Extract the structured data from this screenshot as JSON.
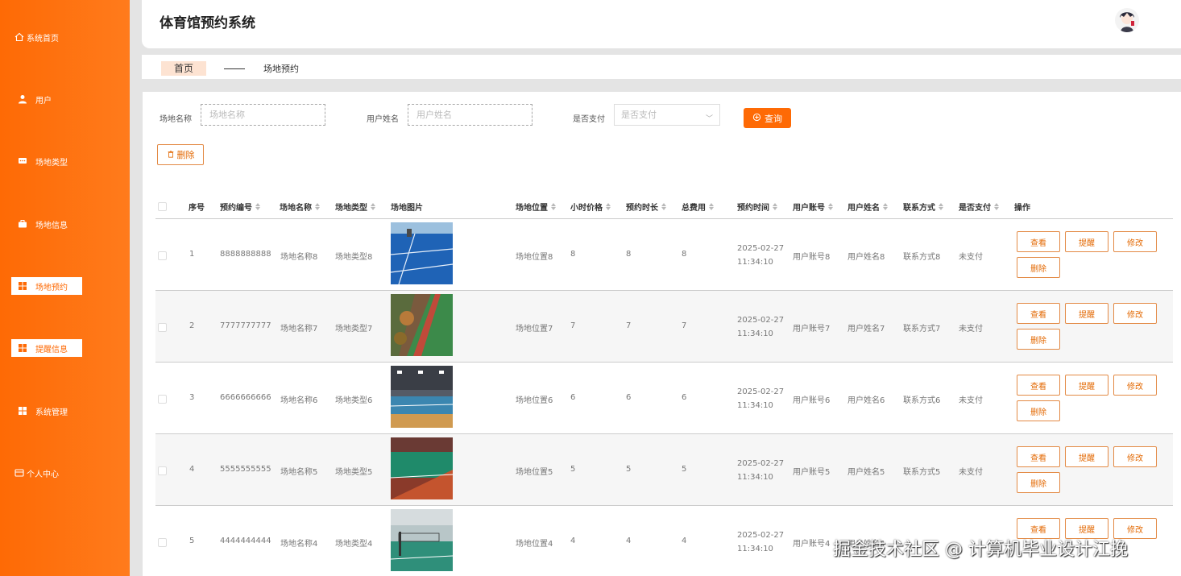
{
  "header": {
    "title": "体育馆预约系统"
  },
  "sidebar": {
    "items": [
      {
        "label": "系统首页",
        "icon": "home-icon"
      },
      {
        "label": "用户",
        "icon": "user-icon"
      },
      {
        "label": "场地类型",
        "icon": "message-icon"
      },
      {
        "label": "场地信息",
        "icon": "briefcase-icon"
      },
      {
        "label": "场地预约",
        "icon": "grid-icon"
      },
      {
        "label": "提醒信息",
        "icon": "grid-icon"
      },
      {
        "label": "系统管理",
        "icon": "grid-icon"
      },
      {
        "label": "个人中心",
        "icon": "card-icon"
      }
    ]
  },
  "breadcrumb": {
    "home": "首页",
    "current": "场地预约"
  },
  "search": {
    "venue_name_label": "场地名称",
    "venue_name_placeholder": "场地名称",
    "user_name_label": "用户姓名",
    "user_name_placeholder": "用户姓名",
    "paid_label": "是否支付",
    "paid_placeholder": "是否支付",
    "query_button": "查询"
  },
  "toolbar": {
    "delete_button": "删除"
  },
  "table": {
    "columns": [
      "序号",
      "预约编号",
      "场地名称",
      "场地类型",
      "场地图片",
      "场地位置",
      "小时价格",
      "预约时长",
      "总费用",
      "预约时间",
      "用户账号",
      "用户姓名",
      "联系方式",
      "是否支付",
      "操作"
    ],
    "actions": {
      "view": "查看",
      "remind": "提醒",
      "edit": "修改",
      "delete": "删除"
    },
    "rows": [
      {
        "index": "1",
        "code": "8888888888",
        "name": "场地名称8",
        "type": "场地类型8",
        "location": "场地位置8",
        "price": "8",
        "duration": "8",
        "total": "8",
        "date": "2025-02-27",
        "time": "11:34:10",
        "account": "用户账号8",
        "username": "用户姓名8",
        "contact": "联系方式8",
        "paid": "未支付"
      },
      {
        "index": "2",
        "code": "7777777777",
        "name": "场地名称7",
        "type": "场地类型7",
        "location": "场地位置7",
        "price": "7",
        "duration": "7",
        "total": "7",
        "date": "2025-02-27",
        "time": "11:34:10",
        "account": "用户账号7",
        "username": "用户姓名7",
        "contact": "联系方式7",
        "paid": "未支付"
      },
      {
        "index": "3",
        "code": "6666666666",
        "name": "场地名称6",
        "type": "场地类型6",
        "location": "场地位置6",
        "price": "6",
        "duration": "6",
        "total": "6",
        "date": "2025-02-27",
        "time": "11:34:10",
        "account": "用户账号6",
        "username": "用户姓名6",
        "contact": "联系方式6",
        "paid": "未支付"
      },
      {
        "index": "4",
        "code": "5555555555",
        "name": "场地名称5",
        "type": "场地类型5",
        "location": "场地位置5",
        "price": "5",
        "duration": "5",
        "total": "5",
        "date": "2025-02-27",
        "time": "11:34:10",
        "account": "用户账号5",
        "username": "用户姓名5",
        "contact": "联系方式5",
        "paid": "未支付"
      },
      {
        "index": "5",
        "code": "4444444444",
        "name": "场地名称4",
        "type": "场地类型4",
        "location": "场地位置4",
        "price": "4",
        "duration": "4",
        "total": "4",
        "date": "2025-02-27",
        "time": "11:34:10",
        "account": "用户账号4",
        "username": "用户姓名4",
        "contact": "",
        "paid": ""
      }
    ]
  },
  "watermark": "掘金技术社区 @ 计算机毕业设计江挽",
  "colors": {
    "accent": "#fe6a05",
    "sidebar": "#ff7b1c",
    "button_border": "#e38a45"
  }
}
